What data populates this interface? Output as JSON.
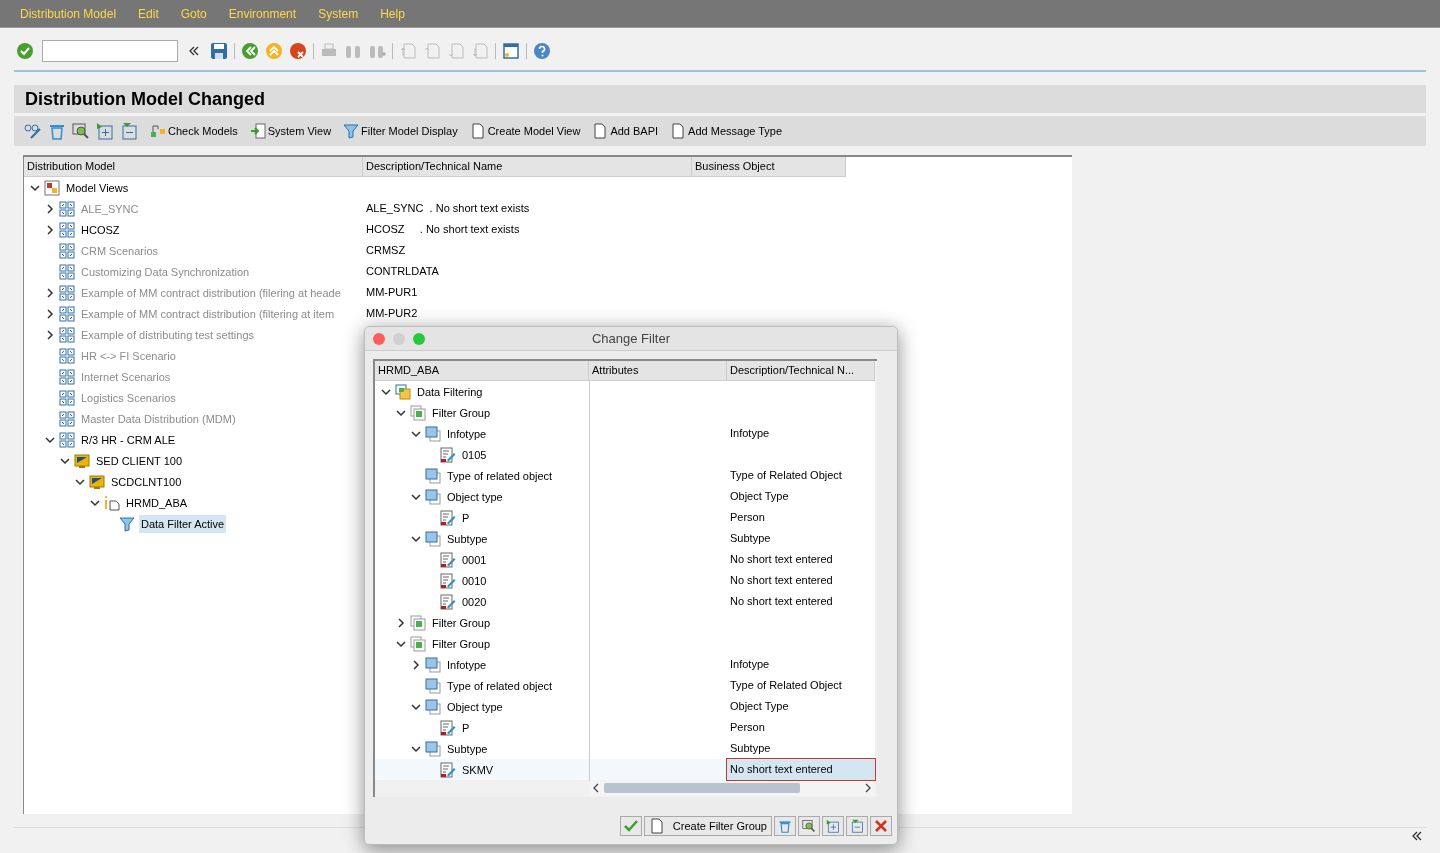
{
  "menu": [
    "Distribution Model",
    "Edit",
    "Goto",
    "Environment",
    "System",
    "Help"
  ],
  "title": "Distribution Model Changed",
  "app_toolbar": [
    "Check Models",
    "System View",
    "Filter Model Display",
    "Create Model View",
    "Add BAPI",
    "Add Message Type"
  ],
  "tree": {
    "columns": [
      "Distribution Model",
      "Description/Technical Name",
      "Business Object"
    ],
    "items": [
      {
        "label": "Model Views",
        "kind": "root",
        "expanded": true,
        "inactive": false,
        "selected": false,
        "children": [
          {
            "label": "ALE_SYNC",
            "description": "ALE_SYNC  . No short text exists",
            "kind": "view",
            "expanded": false,
            "inactive": true,
            "selected": false
          },
          {
            "label": "HCOSZ",
            "description": "HCOSZ     . No short text exists",
            "kind": "view",
            "expanded": false,
            "inactive": false,
            "selected": false
          },
          {
            "label": "CRM Scenarios",
            "description": "CRMSZ",
            "kind": "view",
            "inactive": true,
            "selected": false
          },
          {
            "label": "Customizing Data Synchronization",
            "description": "CONTRLDATA",
            "kind": "view",
            "inactive": true,
            "selected": false
          },
          {
            "label": "Example of MM contract distribution (filering at heade",
            "description": "MM-PUR1",
            "kind": "view",
            "expanded": false,
            "inactive": true,
            "selected": false
          },
          {
            "label": "Example of MM contract distribution (filtering at item",
            "description": "MM-PUR2",
            "kind": "view",
            "expanded": false,
            "inactive": true,
            "selected": false
          },
          {
            "label": "Example of distributing test settings",
            "kind": "view",
            "expanded": false,
            "inactive": true,
            "selected": false
          },
          {
            "label": "HR <-> FI Scenario",
            "kind": "view",
            "inactive": true,
            "selected": false
          },
          {
            "label": "Internet Scenarios",
            "kind": "view",
            "inactive": true,
            "selected": false
          },
          {
            "label": "Logistics Scenarios",
            "kind": "view",
            "inactive": true,
            "selected": false
          },
          {
            "label": "Master Data Distribution (MDM)",
            "kind": "view",
            "inactive": true,
            "selected": false
          },
          {
            "label": "R/3 HR - CRM ALE",
            "kind": "view",
            "expanded": true,
            "inactive": false,
            "selected": false,
            "children": [
              {
                "label": "SED CLIENT 100",
                "kind": "client",
                "expanded": true,
                "inactive": false,
                "selected": false,
                "children": [
                  {
                    "label": "SCDCLNT100",
                    "kind": "client",
                    "expanded": true,
                    "inactive": false,
                    "selected": false,
                    "children": [
                      {
                        "label": "HRMD_ABA",
                        "kind": "message",
                        "expanded": true,
                        "inactive": false,
                        "selected": false,
                        "children": [
                          {
                            "label": "Data Filter Active",
                            "kind": "filter",
                            "inactive": false,
                            "selected": true
                          }
                        ]
                      }
                    ]
                  }
                ]
              }
            ]
          }
        ]
      }
    ]
  },
  "dialog": {
    "title": "Change Filter",
    "columns": [
      "HRMD_ABA",
      "Attributes",
      "Description/Technical N..."
    ],
    "items": [
      {
        "label": "Data Filtering",
        "kind": "datafilter",
        "expanded": true,
        "selected": false,
        "children": [
          {
            "label": "Filter Group",
            "kind": "group",
            "expanded": true,
            "selected": false,
            "children": [
              {
                "label": "Infotype",
                "description": "Infotype",
                "kind": "object",
                "expanded": true,
                "selected": false,
                "children": [
                  {
                    "label": "0105",
                    "kind": "value",
                    "selected": false
                  }
                ]
              },
              {
                "label": "Type of related object",
                "description": "Type of Related Object",
                "kind": "object",
                "selected": false
              },
              {
                "label": "Object type",
                "description": "Object Type",
                "kind": "object",
                "expanded": true,
                "selected": false,
                "children": [
                  {
                    "label": "P",
                    "description": "Person",
                    "kind": "value",
                    "selected": false
                  }
                ]
              },
              {
                "label": "Subtype",
                "description": "Subtype",
                "kind": "object",
                "expanded": true,
                "selected": false,
                "children": [
                  {
                    "label": "0001",
                    "description": "No short text entered",
                    "kind": "value",
                    "selected": false
                  },
                  {
                    "label": "0010",
                    "description": "No short text entered",
                    "kind": "value",
                    "selected": false
                  },
                  {
                    "label": "0020",
                    "description": "No short text entered",
                    "kind": "value",
                    "selected": false
                  }
                ]
              }
            ]
          },
          {
            "label": "Filter Group",
            "kind": "group",
            "expanded": false,
            "selected": false
          },
          {
            "label": "Filter Group",
            "kind": "group",
            "expanded": true,
            "selected": false,
            "children": [
              {
                "label": "Infotype",
                "description": "Infotype",
                "kind": "object",
                "expanded": false,
                "selected": false
              },
              {
                "label": "Type of related object",
                "description": "Type of Related Object",
                "kind": "object",
                "selected": false
              },
              {
                "label": "Object type",
                "description": "Object Type",
                "kind": "object",
                "expanded": true,
                "selected": false,
                "children": [
                  {
                    "label": "P",
                    "description": "Person",
                    "kind": "value",
                    "selected": false
                  }
                ]
              },
              {
                "label": "Subtype",
                "description": "Subtype",
                "kind": "object",
                "expanded": true,
                "selected": false,
                "children": [
                  {
                    "label": "SKMV",
                    "description": "No short text entered",
                    "kind": "value",
                    "selected": true
                  }
                ]
              }
            ]
          }
        ]
      }
    ],
    "button": "Create Filter Group"
  }
}
